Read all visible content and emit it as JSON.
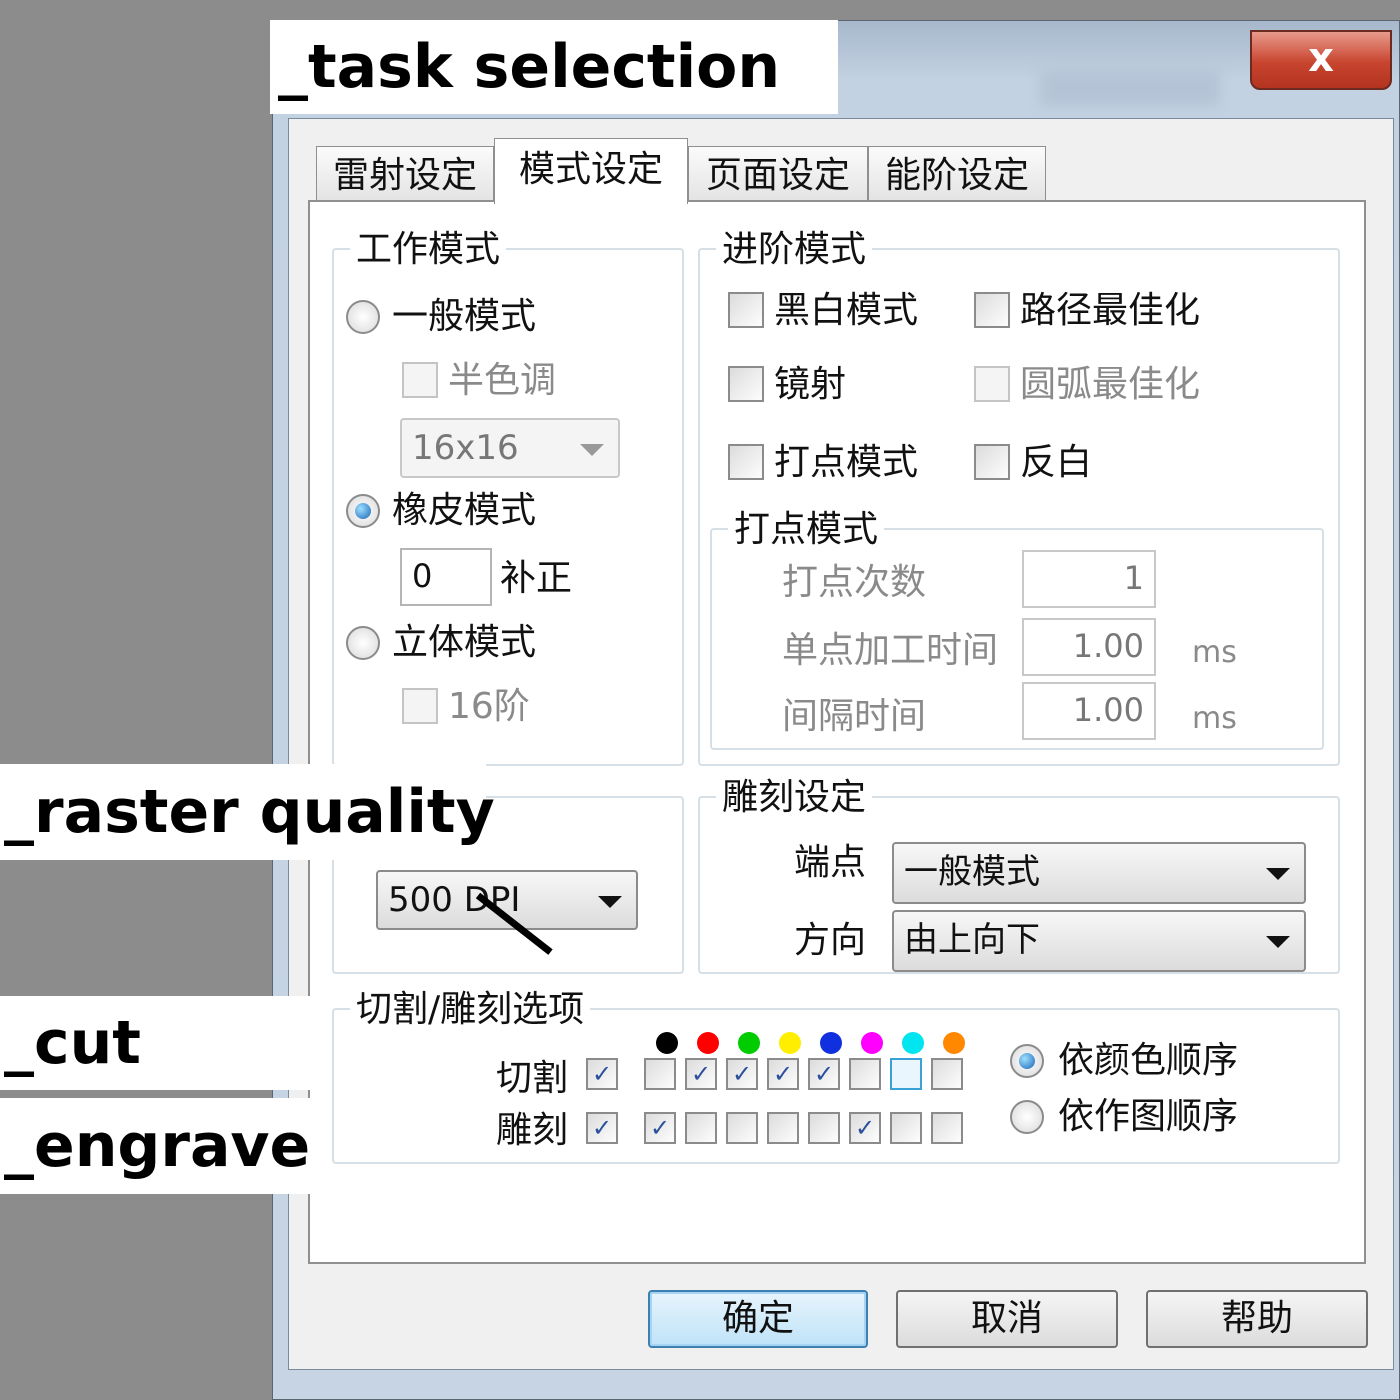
{
  "callouts": {
    "task_selection": "_task selection",
    "raster_quality": "_raster quality",
    "cut": "_cut",
    "engrave": "_engrave"
  },
  "window": {
    "close_glyph": "x"
  },
  "tabs": [
    {
      "label": "雷射设定",
      "active": false
    },
    {
      "label": "模式设定",
      "active": true
    },
    {
      "label": "页面设定",
      "active": false
    },
    {
      "label": "能阶设定",
      "active": false
    }
  ],
  "work_mode": {
    "title": "工作模式",
    "normal_mode": {
      "label": "一般模式",
      "selected": false
    },
    "halftone": {
      "label": "半色调",
      "checked": false,
      "disabled": true
    },
    "halftone_size": {
      "value": "16x16",
      "disabled": true
    },
    "rubber_mode": {
      "label": "橡皮模式",
      "selected": true
    },
    "offset": {
      "value": "0",
      "label": "补正"
    },
    "stereo_mode": {
      "label": "立体模式",
      "selected": false
    },
    "levels16": {
      "label": "16阶",
      "checked": false,
      "disabled": true
    }
  },
  "advanced_mode": {
    "title": "进阶模式",
    "black_white": {
      "label": "黑白模式",
      "checked": false
    },
    "path_optimize": {
      "label": "路径最佳化",
      "checked": false
    },
    "mirror": {
      "label": "镜射",
      "checked": false
    },
    "arc_optimize": {
      "label": "圆弧最佳化",
      "checked": false,
      "disabled": true
    },
    "dot_mode": {
      "label": "打点模式",
      "checked": false
    },
    "invert": {
      "label": "反白",
      "checked": false
    }
  },
  "dot_settings": {
    "title": "打点模式",
    "dot_count": {
      "label": "打点次数",
      "value": "1"
    },
    "single_time": {
      "label": "单点加工时间",
      "value": "1.00",
      "unit": "ms"
    },
    "interval_time": {
      "label": "间隔时间",
      "value": "1.00",
      "unit": "ms"
    }
  },
  "resolution": {
    "value": "500 DPI"
  },
  "engrave_settings": {
    "title": "雕刻设定",
    "endpoint": {
      "label": "端点",
      "value": "一般模式"
    },
    "direction": {
      "label": "方向",
      "value": "由上向下"
    }
  },
  "cut_engrave_options": {
    "title": "切割/雕刻选项",
    "colors": [
      "#000000",
      "#ff0000",
      "#00cc00",
      "#ffee00",
      "#1030e0",
      "#ff00ff",
      "#00e5f0",
      "#ff8800"
    ],
    "cut": {
      "label": "切割",
      "master": true,
      "colors": [
        false,
        true,
        true,
        true,
        true,
        false,
        false,
        false
      ]
    },
    "engrave": {
      "label": "雕刻",
      "master": true,
      "colors": [
        true,
        false,
        false,
        false,
        false,
        true,
        false,
        false
      ]
    },
    "order_by_color": {
      "label": "依颜色顺序",
      "selected": true
    },
    "order_by_drawing": {
      "label": "依作图顺序",
      "selected": false
    }
  },
  "buttons": {
    "ok": "确定",
    "cancel": "取消",
    "help": "帮助"
  }
}
